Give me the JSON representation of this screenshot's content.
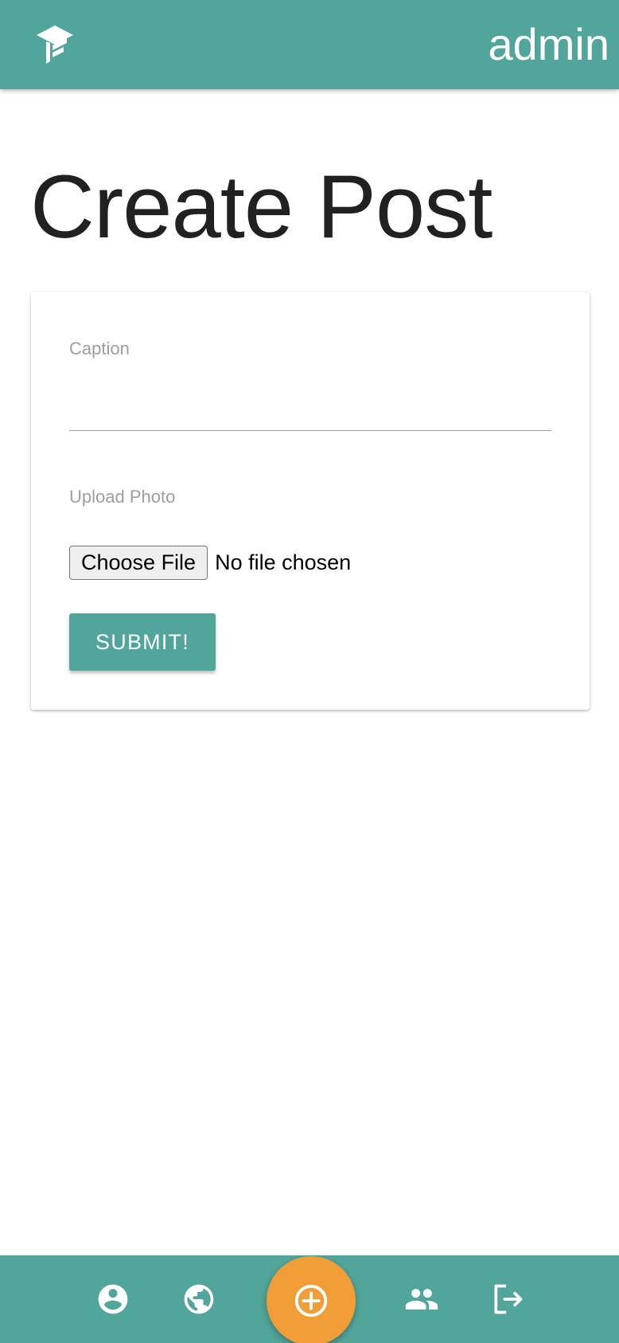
{
  "header": {
    "logo_icon": "graduation-cap-logo-icon",
    "username": "admin",
    "bar_color": "#52a59a"
  },
  "page": {
    "title": "Create Post"
  },
  "form": {
    "caption_label": "Caption",
    "caption_value": "",
    "upload_label": "Upload Photo",
    "choose_file_label": "Choose File",
    "file_status": "No file chosen",
    "submit_label": "SUBMIT!"
  },
  "bottom_nav": {
    "items": [
      {
        "icon": "account-circle-icon"
      },
      {
        "icon": "globe-icon"
      },
      {
        "icon": "add-circle-icon",
        "accent": "#f29e38"
      },
      {
        "icon": "people-icon"
      },
      {
        "icon": "logout-icon"
      }
    ]
  }
}
